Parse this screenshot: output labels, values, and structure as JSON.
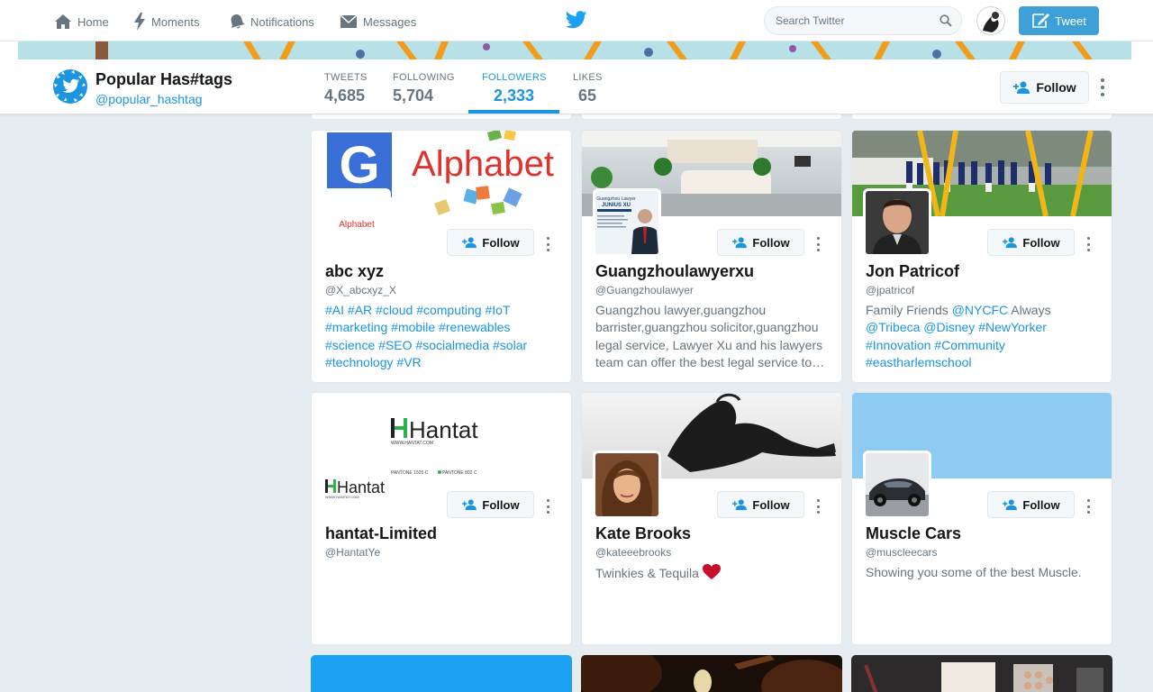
{
  "nav": {
    "items": [
      {
        "label": "Home",
        "icon": "home-icon"
      },
      {
        "label": "Moments",
        "icon": "lightning-icon"
      },
      {
        "label": "Notifications",
        "icon": "bell-icon"
      },
      {
        "label": "Messages",
        "icon": "envelope-icon"
      }
    ],
    "search_placeholder": "Search Twitter",
    "tweet_label": "Tweet"
  },
  "profile": {
    "name": "Popular Has#tags",
    "handle": "@popular_hashtag",
    "stats": [
      {
        "label": "TWEETS",
        "value": "4,685"
      },
      {
        "label": "FOLLOWING",
        "value": "5,704"
      },
      {
        "label": "FOLLOWERS",
        "value": "2,333",
        "active": true
      },
      {
        "label": "LIKES",
        "value": "65"
      }
    ],
    "follow_label": "Follow"
  },
  "cards": [
    {
      "name": "abc xyz",
      "handle": "@X_abcxyz_X",
      "follow_label": "Follow",
      "banner_text": "Alphabet",
      "avatar_text": "Alphabet",
      "bio_tags": [
        "#AI",
        "#AR",
        "#cloud",
        "#computing",
        "#IoT",
        "#marketing",
        "#mobile",
        "#renewables",
        "#science",
        "#SEO",
        "#socialmedia",
        "#solar",
        "#technology",
        "#VR"
      ]
    },
    {
      "name": "Guangzhoulawyerxu",
      "handle": "@Guangzhoulawyer",
      "follow_label": "Follow",
      "bio": "Guangzhou lawyer,guangzhou barrister,guangzhou solicitor,guangzhou legal service, Lawyer Xu and his lawyers team can offer the best legal service to your business",
      "avatar_text_1": "Guangzhou Lawyer",
      "avatar_text_2": "JUNIUS XU"
    },
    {
      "name": "Jon Patricof",
      "handle": "@jpatricof",
      "follow_label": "Follow",
      "bio_parts": [
        {
          "text": "Family Friends ",
          "tag": false
        },
        {
          "text": "@NYCFC",
          "tag": true
        },
        {
          "text": " Always ",
          "tag": false
        },
        {
          "text": "@Tribeca",
          "tag": true
        },
        {
          "text": " ",
          "tag": false
        },
        {
          "text": "@Disney",
          "tag": true
        },
        {
          "text": " ",
          "tag": false
        },
        {
          "text": "#NewYorker",
          "tag": true
        },
        {
          "text": " ",
          "tag": false
        },
        {
          "text": "#Innovation",
          "tag": true
        },
        {
          "text": " ",
          "tag": false
        },
        {
          "text": "#Community",
          "tag": true
        },
        {
          "text": " ",
          "tag": false
        },
        {
          "text": "#eastharlemschool",
          "tag": true
        }
      ]
    },
    {
      "name": "hantat-Limited",
      "handle": "@HantatYe",
      "follow_label": "Follow",
      "banner_logo": "Hantat",
      "banner_url": "WWW.HANTAT.COM",
      "pantone_1": "PANTONE 1505 C",
      "pantone_2": "PANTONE 802 C",
      "bio": ""
    },
    {
      "name": "Kate Brooks",
      "handle": "@kateeebrooks",
      "follow_label": "Follow",
      "bio": "Twinkies & Tequila"
    },
    {
      "name": "Muscle Cars",
      "handle": "@muscleecars",
      "follow_label": "Follow",
      "bio": "Showing you some of the best Muscle."
    }
  ],
  "colors": {
    "link_blue": "#1b95e0",
    "tweet_button": "#3ea0d6",
    "page_bg": "#e6ecf0",
    "muscle_banner": "#8ecbf2"
  }
}
